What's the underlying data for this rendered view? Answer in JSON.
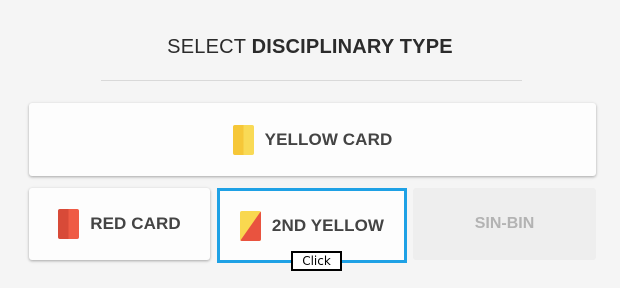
{
  "header": {
    "title_pre": "SELECT",
    "title_bold": "DISCIPLINARY TYPE"
  },
  "options": {
    "yellow": {
      "label": "YELLOW CARD",
      "icon": "yellow-card-icon",
      "color": "#f9d84f"
    },
    "red": {
      "label": "RED CARD",
      "icon": "red-card-icon",
      "color": "#e9533f"
    },
    "second_yellow": {
      "label": "2ND YELLOW",
      "icon": "second-yellow-card-icon",
      "selected": true
    },
    "sin_bin": {
      "label": "SIN-BIN",
      "disabled": true
    }
  },
  "tooltip": {
    "text": "Click"
  },
  "colors": {
    "highlight": "#1ea1e5",
    "text": "#444444",
    "disabled_text": "#b3b3b3"
  }
}
